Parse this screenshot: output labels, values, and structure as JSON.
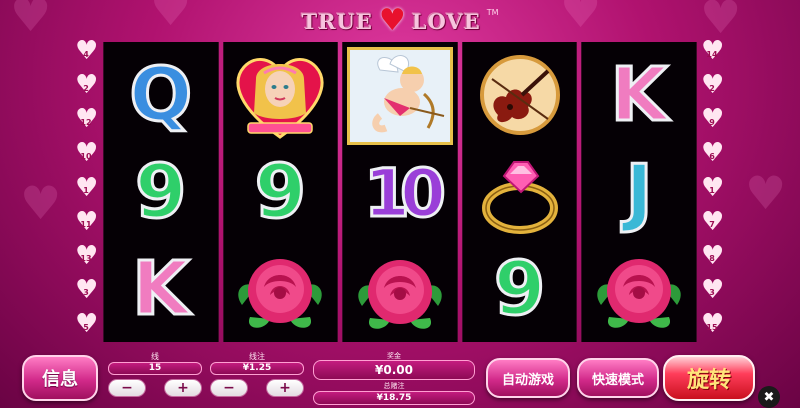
{
  "logo": {
    "word1": "TRUE",
    "word2": "LOVE",
    "tm": "TM",
    "heart": "♥"
  },
  "paylines": {
    "left": [
      "4",
      "2",
      "12",
      "10",
      "1",
      "11",
      "13",
      "3",
      "5"
    ],
    "right": [
      "14",
      "2",
      "9",
      "6",
      "1",
      "7",
      "8",
      "3",
      "15"
    ]
  },
  "reels": [
    {
      "top": "Q",
      "mid": "9",
      "bot": "K"
    },
    {
      "top": "princess",
      "mid": "9",
      "bot": "rose"
    },
    {
      "top": "cupid",
      "mid": "10",
      "bot": "rose"
    },
    {
      "top": "violin",
      "mid": "ring",
      "bot": "9"
    },
    {
      "top": "K",
      "mid": "J",
      "bot": "rose"
    }
  ],
  "controls": {
    "info_label": "信息",
    "lines_label": "线",
    "lines_value": "15",
    "linebet_label": "线注",
    "linebet_value": "¥1.25",
    "win_label": "奖金",
    "win_value": "¥0.00",
    "totalbet_label": "总赌注",
    "totalbet_value": "¥18.75",
    "minus": "−",
    "plus": "+",
    "autoplay_label": "自动游戏",
    "fastmode_label": "快速模式",
    "spin_label": "旋转",
    "close_icon": "✖"
  },
  "colors": {
    "accent": "#d22a8a",
    "spin": "#ff3d5a",
    "spin_text": "#ffe37a"
  }
}
